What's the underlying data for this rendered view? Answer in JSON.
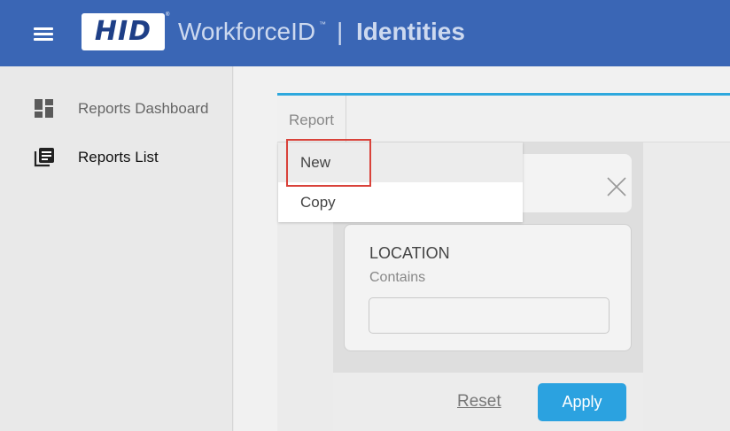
{
  "header": {
    "logo_text": "HID",
    "logo_reg": "®",
    "app_name": "WorkforceID",
    "app_tm": "™",
    "separator": "|",
    "section": "Identities"
  },
  "sidebar": {
    "items": [
      {
        "label": "Reports Dashboard",
        "icon": "dashboard-icon"
      },
      {
        "label": "Reports List",
        "icon": "list-icon"
      }
    ]
  },
  "toolbar": {
    "report_label": "Report"
  },
  "dropdown": {
    "items": [
      {
        "label": "New"
      },
      {
        "label": "Copy"
      }
    ]
  },
  "filter": {
    "location_title": "LOCATION",
    "location_operator": "Contains",
    "location_value": ""
  },
  "actions": {
    "reset_label": "Reset",
    "apply_label": "Apply"
  },
  "colors": {
    "header_bg": "#3a66b5",
    "accent": "#2ea8dd",
    "apply_button": "#2ba2e0",
    "highlight": "#d9423a"
  }
}
